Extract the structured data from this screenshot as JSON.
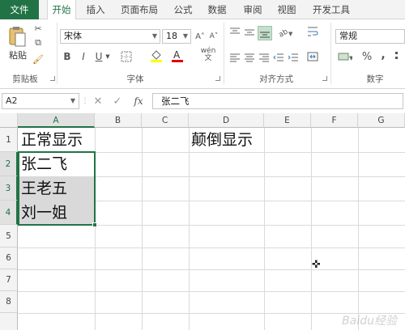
{
  "tabs": [
    "文件",
    "开始",
    "插入",
    "页面布局",
    "公式",
    "数据",
    "审阅",
    "视图",
    "开发工具"
  ],
  "ribbon": {
    "paste_label": "粘贴",
    "clipboard_label": "剪贴板",
    "font_group_label": "字体",
    "align_group_label": "对齐方式",
    "number_group_label": "数字",
    "font_name": "宋体",
    "font_size": "18",
    "number_format": "常规",
    "font_grow": "A˄",
    "font_shrink": "A˅",
    "bold": "B",
    "italic": "I",
    "underline": "U",
    "wen": "wén",
    "percent": "%",
    "comma": ","
  },
  "formula_bar": {
    "name_box": "A2",
    "fx": "fx",
    "content": "张二飞"
  },
  "grid": {
    "columns": [
      "A",
      "B",
      "C",
      "D",
      "E",
      "F",
      "G"
    ],
    "rows": [
      "1",
      "2",
      "3",
      "4",
      "5",
      "6",
      "7",
      "8"
    ],
    "cells": {
      "A1": "正常显示",
      "D1": "颠倒显示",
      "A2": "张二飞",
      "A3": "王老五",
      "A4": "刘一姐"
    }
  },
  "watermark": "Baidu经验"
}
